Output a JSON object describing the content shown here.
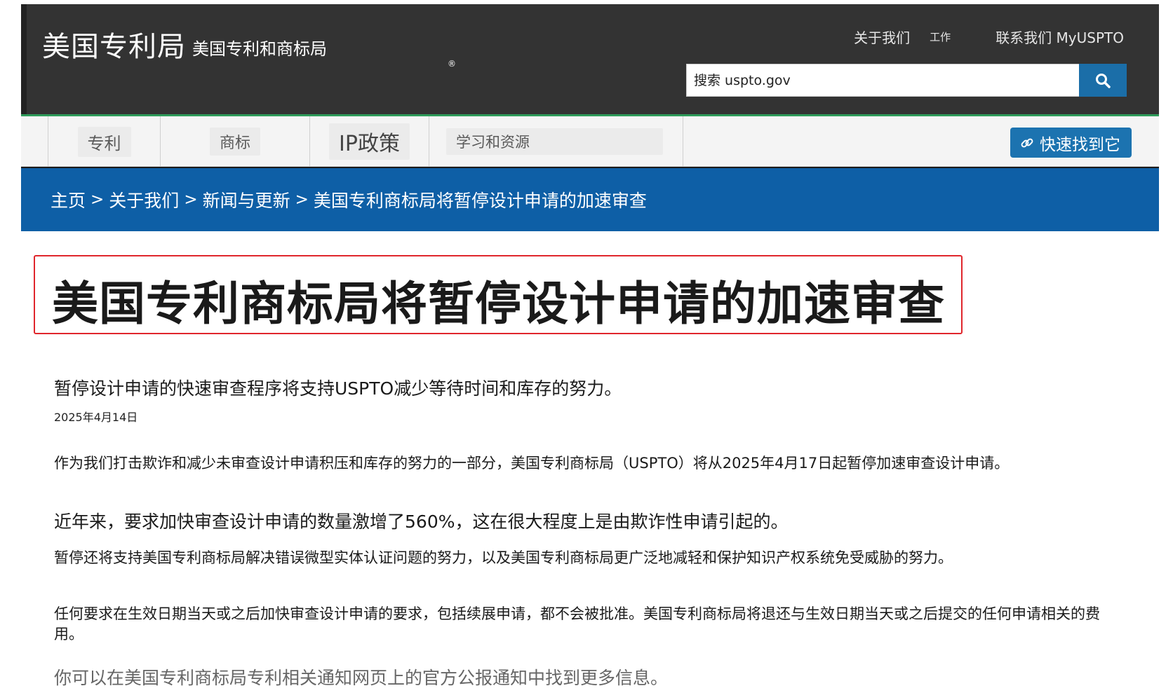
{
  "header": {
    "logo_main": "美国专利局",
    "logo_sub": "美国专利和商标局",
    "registered_mark": "®",
    "links": {
      "about": "关于我们",
      "jobs": "工作",
      "contact": "联系我们 MyUSPTO"
    },
    "search": {
      "placeholder": "搜索 uspto.gov",
      "button_icon": "search-icon"
    }
  },
  "nav": {
    "items": [
      "专利",
      "商标",
      "IP政策",
      "学习和资源"
    ],
    "quick_find": {
      "label": "快速找到它",
      "icon": "link-icon"
    }
  },
  "breadcrumb": [
    "主页",
    "关于我们",
    "新闻与更新",
    "美国专利商标局将暂停设计申请的加速审查"
  ],
  "breadcrumb_separator": ">",
  "article": {
    "title": "美国专利商标局将暂停设计申请的加速审查",
    "lead": "暂停设计申请的快速审查程序将支持USPTO减少等待时间和库存的努力。",
    "date": "2025年4月14日",
    "paragraphs": [
      "作为我们打击欺诈和减少未审查设计申请积压和库存的努力的一部分，美国专利商标局（USPTO）将从2025年4月17日起暂停加速审查设计申请。",
      "近年来，要求加快审查设计申请的数量激增了560%，这在很大程度上是由欺诈性申请引起的。",
      "暂停还将支持美国专利商标局解决错误微型实体认证问题的努力，以及美国专利商标局更广泛地减轻和保护知识产权系统免受威胁的努力。",
      "任何要求在生效日期当天或之后加快审查设计申请的要求，包括续展申请，都不会被批准。美国专利商标局将退还与生效日期当天或之后提交的任何申请相关的费用。"
    ],
    "more_info": "你可以在美国专利商标局专利相关通知网页上的官方公报通知中找到更多信息。"
  },
  "colors": {
    "header_bg": "#333333",
    "nav_bg": "#f4f4f4",
    "breadcrumb_bg": "#0e5fa6",
    "accent_blue": "#1c73b0",
    "highlight_red": "#e0262c",
    "nav_top_border": "#2e9b5a"
  }
}
